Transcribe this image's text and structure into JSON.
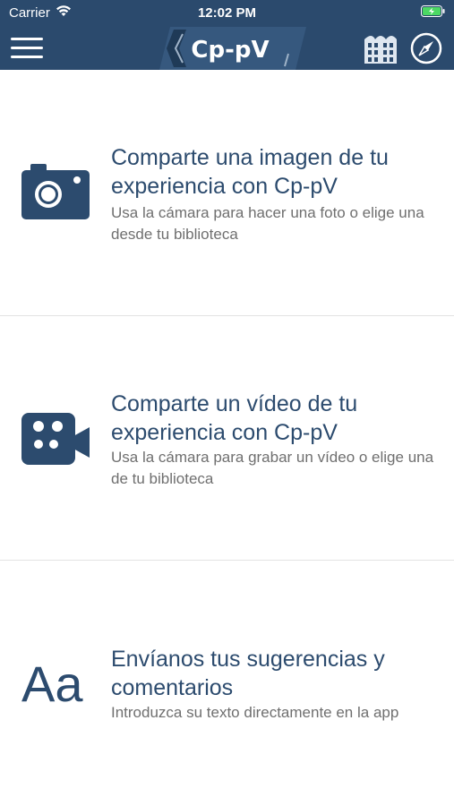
{
  "status_bar": {
    "carrier": "Carrier",
    "time": "12:02 PM"
  },
  "nav": {
    "logo": "Cp-pV",
    "icons": [
      "hamburger-menu-icon",
      "building-icon",
      "compass-icon"
    ]
  },
  "options": [
    {
      "icon": "camera-icon",
      "title": "Comparte una imagen de tu experiencia con Cp-pV",
      "description": "Usa la cámara para hacer una foto o elige una desde tu biblioteca"
    },
    {
      "icon": "video-camera-icon",
      "title": "Comparte un vídeo de tu experiencia con Cp-pV",
      "description": "Usa la cámara para grabar un vídeo o elige una de tu biblioteca"
    },
    {
      "icon": "text-icon",
      "icon_text": "Aa",
      "title": "Envíanos tus sugerencias y comentarios",
      "description": "Introduzca su texto directamente en la app"
    }
  ],
  "colors": {
    "header": "#2b4a6d",
    "accent": "#2c4b6e",
    "description": "#6f6f6f"
  }
}
